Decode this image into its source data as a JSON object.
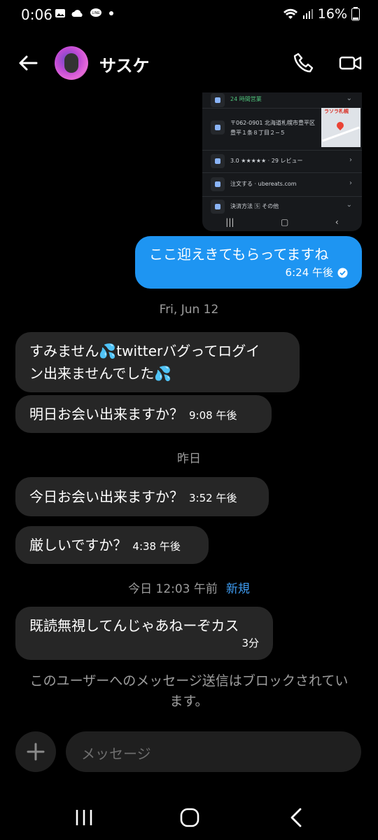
{
  "status_bar": {
    "time": "0:06",
    "battery": "16%",
    "left_icons": [
      "image-icon",
      "cloud-icon",
      "line-app-icon",
      "dot-icon"
    ],
    "right_icons": [
      "wifi-icon",
      "signal-icon",
      "battery-icon"
    ]
  },
  "header": {
    "contact_name": "サスケ"
  },
  "shared_image": {
    "hours": "24 時間営業",
    "address_line1": "〒062-0901 北海道札幌市豊平区",
    "address_line2": "豊平１条８丁目２−５",
    "map_label": "ラソラ札幌",
    "rating": "3.0 ★★★★★ · 29 レビュー",
    "order": "注文する · ubereats.com",
    "payment": "決済方法 🅂 その他"
  },
  "messages": [
    {
      "id": "m1",
      "dir": "out",
      "text": "ここ迎えきてもらってますね",
      "time": "6:24 午後"
    },
    {
      "id": "sep1",
      "dir": "sep",
      "text": "Fri, Jun 12"
    },
    {
      "id": "m2",
      "dir": "in",
      "line1": "すみません💦twitterバグってログイ",
      "line2": "ン出来ませんでした💦"
    },
    {
      "id": "m3",
      "dir": "in",
      "text": "明日お会い出来ますか？",
      "time": "9:08 午後"
    },
    {
      "id": "sep2",
      "dir": "sep",
      "text": "昨日"
    },
    {
      "id": "m4",
      "dir": "in",
      "text": "今日お会い出来ますか？",
      "time": "3:52 午後"
    },
    {
      "id": "m5",
      "dir": "in",
      "text": "厳しいですか？",
      "time": "4:38 午後"
    },
    {
      "id": "sep3",
      "dir": "sep",
      "text": "今日 12:03 午前",
      "badge": "新規"
    },
    {
      "id": "m6",
      "dir": "in",
      "text": "既読無視してんじゃあねーぞカス",
      "time": "3分"
    }
  ],
  "block_notice": {
    "line1": "このユーザーへのメッセージ送信はブロックされてい",
    "line2": "ます。"
  },
  "composer": {
    "placeholder": "メッセージ"
  },
  "colors": {
    "outgoing_bubble": "#1e95f2",
    "incoming_bubble": "#262626",
    "new_badge": "#3e9bf0"
  }
}
